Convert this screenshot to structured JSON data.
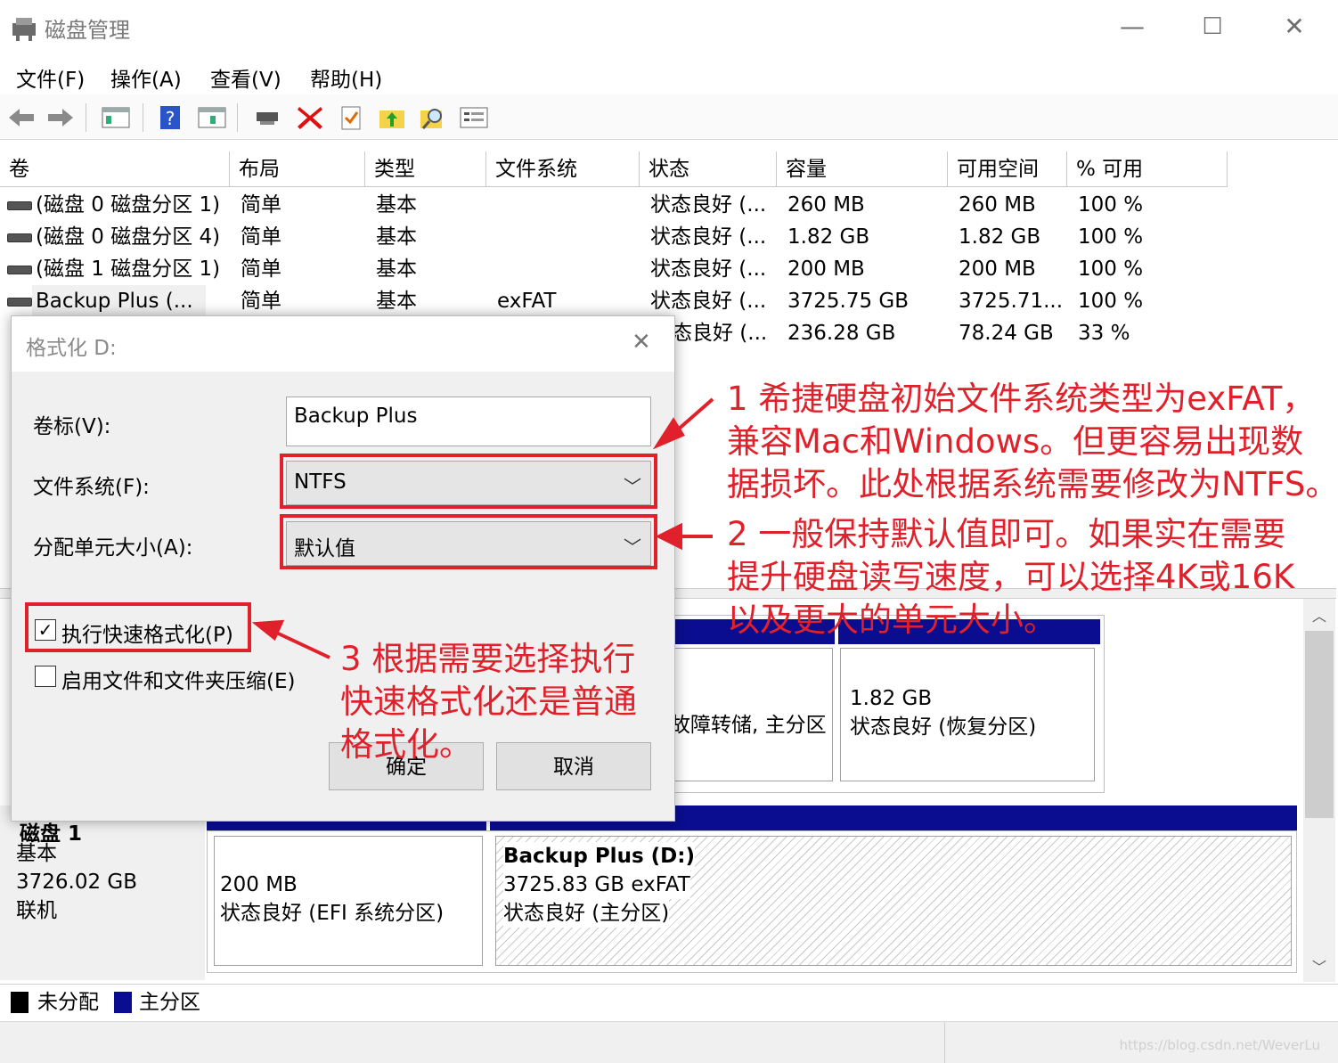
{
  "window": {
    "title": "磁盘管理",
    "minimize": "—",
    "maximize": "☐",
    "close": "✕"
  },
  "menu": [
    "文件(F)",
    "操作(A)",
    "查看(V)",
    "帮助(H)"
  ],
  "toolbar_icons": [
    "back-icon",
    "forward-icon",
    "console-icon",
    "help-icon",
    "view-icon",
    "connect-icon",
    "delete-icon",
    "check-icon",
    "folder-up-icon",
    "search-icon",
    "properties-icon"
  ],
  "table": {
    "headers": [
      "卷",
      "布局",
      "类型",
      "文件系统",
      "状态",
      "容量",
      "可用空间",
      "% 可用"
    ],
    "rows": [
      [
        "(磁盘 0 磁盘分区 1)",
        "简单",
        "基本",
        "",
        "状态良好 (...",
        "260 MB",
        "260 MB",
        "100 %"
      ],
      [
        "(磁盘 0 磁盘分区 4)",
        "简单",
        "基本",
        "",
        "状态良好 (...",
        "1.82 GB",
        "1.82 GB",
        "100 %"
      ],
      [
        "(磁盘 1 磁盘分区 1)",
        "简单",
        "基本",
        "",
        "状态良好 (...",
        "200 MB",
        "200 MB",
        "100 %"
      ],
      [
        "Backup Plus (...",
        "简单",
        "基本",
        "exFAT",
        "状态良好 (...",
        "3725.75 GB",
        "3725.71...",
        "100 %"
      ],
      [
        "",
        "",
        "",
        "",
        "态良好 (...",
        "236.28 GB",
        "78.24 GB",
        "33 %"
      ]
    ]
  },
  "disk0_partitions": {
    "mid_text": "故障转储, 主分区",
    "right_size": "1.82 GB",
    "right_status": "状态良好 (恢复分区)"
  },
  "disk1": {
    "name": "磁盘 1",
    "type": "基本",
    "size": "3726.02 GB",
    "state": "联机",
    "efi": {
      "size": "200 MB",
      "status": "状态良好 (EFI 系统分区)"
    },
    "main": {
      "name": "Backup Plus  (D:)",
      "size": "3725.83 GB exFAT",
      "status": "状态良好 (主分区)"
    }
  },
  "legend": {
    "unallocated": "未分配",
    "primary": "主分区",
    "unallocated_color": "#000000",
    "primary_color": "#0a0d8f"
  },
  "dialog": {
    "title": "格式化 D:",
    "close": "✕",
    "volume_label": "卷标(V):",
    "volume_value": "Backup Plus",
    "fs_label": "文件系统(F):",
    "fs_value": "NTFS",
    "alloc_label": "分配单元大小(A):",
    "alloc_value": "默认值",
    "quick_format": "执行快速格式化(P)",
    "quick_checked": "✓",
    "compress": "启用文件和文件夹压缩(E)",
    "ok": "确定",
    "cancel": "取消"
  },
  "annotations": {
    "note1": [
      "1 希捷硬盘初始文件系统类型为exFAT，",
      "兼容Mac和Windows。但更容易出现数",
      "据损坏。此处根据系统需要修改为NTFS。"
    ],
    "note2": [
      "2 一般保持默认值即可。如果实在需要",
      "提升硬盘读写速度，可以选择4K或16K",
      "以及更大的单元大小。"
    ],
    "note3": [
      "3 根据需要选择执行",
      "快速格式化还是普通",
      "格式化。"
    ],
    "color": "#e0202a"
  },
  "watermark": "https://blog.csdn.net/WeverLu"
}
